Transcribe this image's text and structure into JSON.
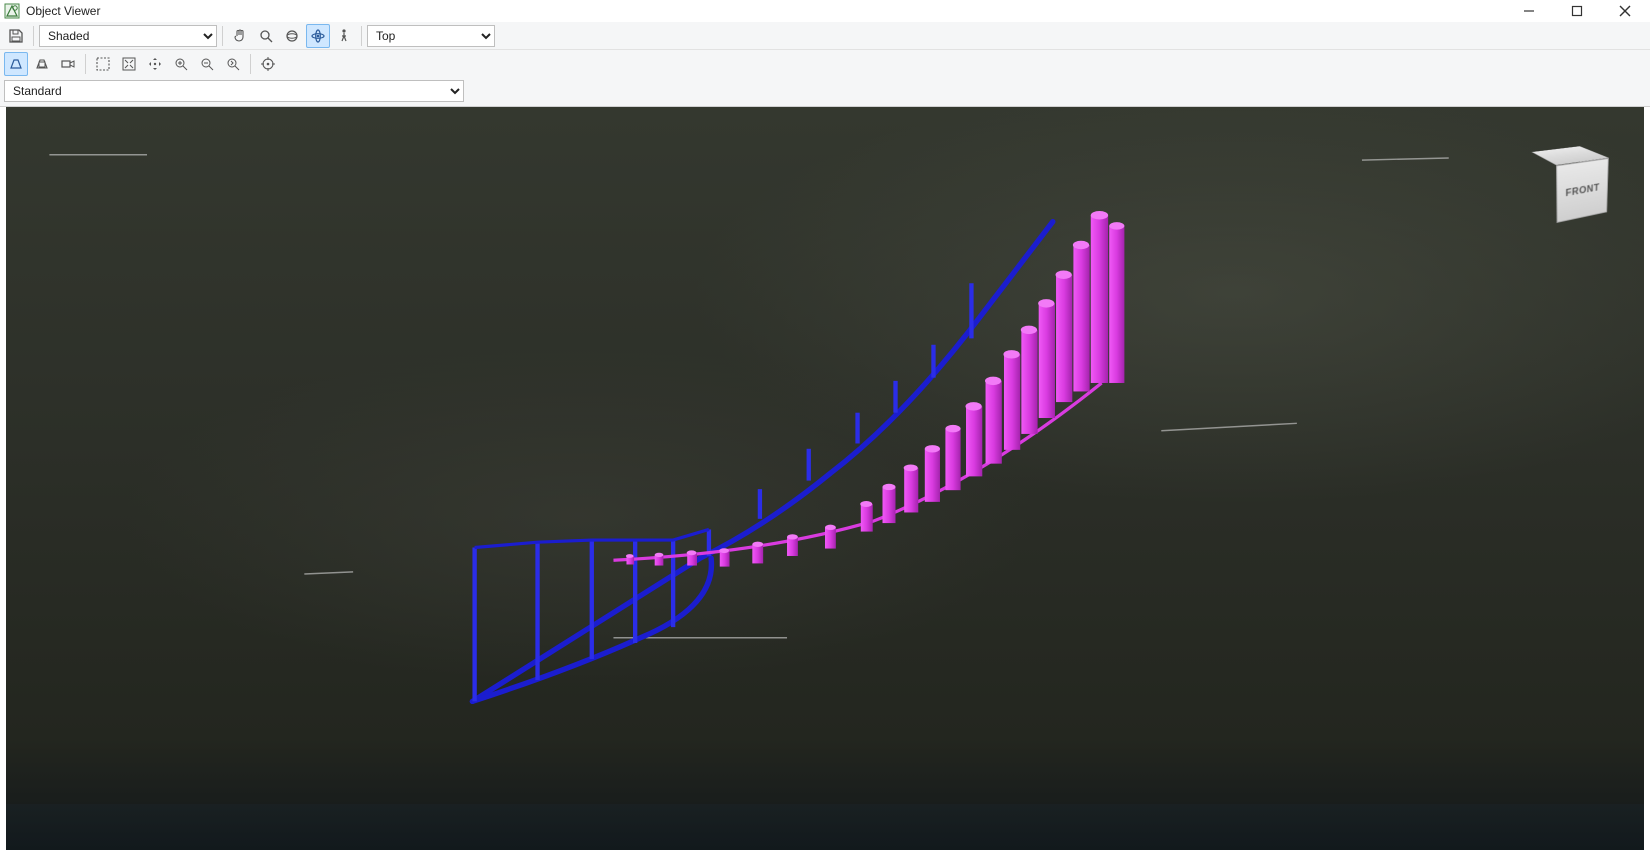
{
  "window": {
    "title": "Object Viewer"
  },
  "toolbar": {
    "visual_style": {
      "value": "Shaded"
    },
    "view_direction": {
      "value": "Top"
    }
  },
  "standard_select": {
    "value": "Standard"
  },
  "viewcube": {
    "front_label": "FRONT"
  },
  "icons": {
    "save": "save-icon",
    "pan": "pan-icon",
    "zoom": "zoom-icon",
    "orbit_free": "orbit-free-icon",
    "orbit_constrained": "orbit-constrained-icon",
    "walk": "walk-icon",
    "persp": "perspective-toggle-icon",
    "persp_obj": "perspective-object-icon",
    "camera": "camera-icon",
    "zoom_window": "zoom-window-icon",
    "zoom_extents": "zoom-extents-icon",
    "pan_realtime": "pan-realtime-icon",
    "zoom_in": "zoom-in-icon",
    "zoom_out": "zoom-out-icon",
    "zoom_realtime": "zoom-realtime-icon",
    "target": "target-icon"
  },
  "colors": {
    "terrain_bg": "#2a2d28",
    "blue_line": "#1b1dcf",
    "blue_post": "#2b2de8",
    "magenta": "#d93be0",
    "magenta_dark": "#b52ac0"
  }
}
